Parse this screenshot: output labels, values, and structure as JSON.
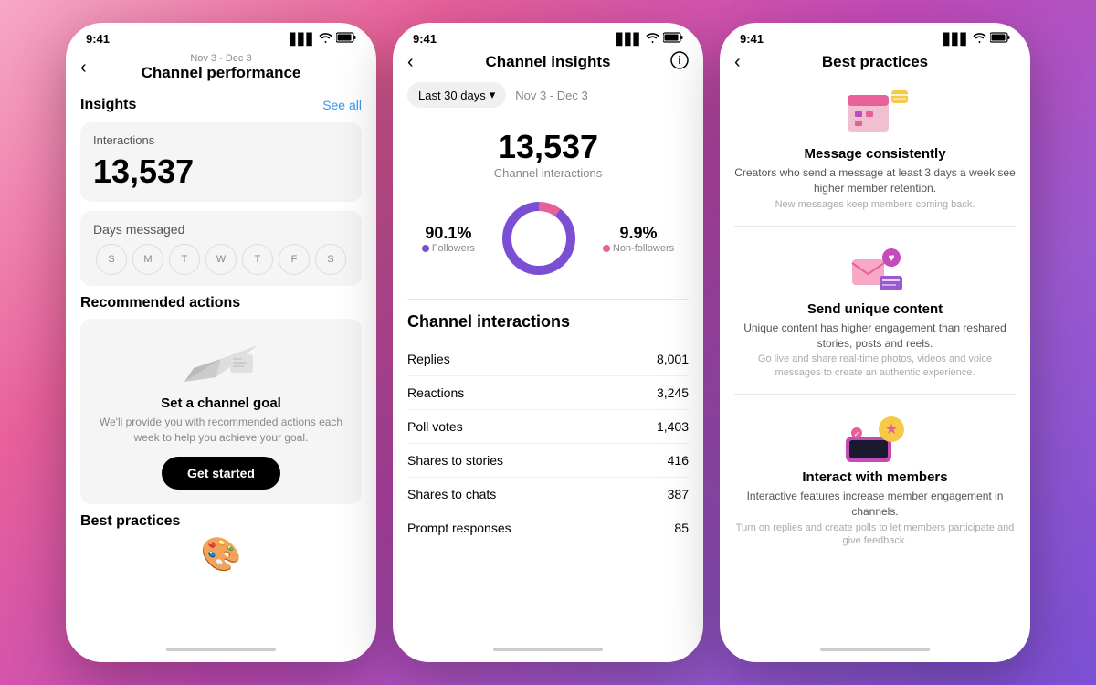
{
  "phone1": {
    "statusBar": {
      "time": "9:41",
      "signal": "▋▋▋",
      "wifi": "wifi",
      "battery": "🔋"
    },
    "nav": {
      "back": "‹",
      "dateRange": "Nov 3 - Dec 3",
      "title": "Channel performance"
    },
    "insights": {
      "sectionTitle": "Insights",
      "seeAll": "See all",
      "interactionsLabel": "Interactions",
      "interactionsValue": "13,537",
      "daysMessaged": "Days messaged",
      "days": [
        "S",
        "M",
        "T",
        "W",
        "T",
        "F",
        "S"
      ]
    },
    "recommended": {
      "title": "Recommended actions",
      "goalTitle": "Set a channel goal",
      "goalDesc": "We'll provide you with recommended actions each week to help you achieve your goal.",
      "buttonLabel": "Get started"
    },
    "bestPractices": {
      "title": "Best practices"
    }
  },
  "phone2": {
    "statusBar": {
      "time": "9:41"
    },
    "nav": {
      "back": "‹",
      "title": "Channel insights"
    },
    "dateFilter": {
      "label": "Last 30 days",
      "dateRange": "Nov 3 - Dec 3"
    },
    "hero": {
      "number": "13,537",
      "label": "Channel interactions"
    },
    "donut": {
      "followers": {
        "pct": "90.1%",
        "label": "Followers",
        "color": "#7b4fd4"
      },
      "nonFollowers": {
        "pct": "9.9%",
        "label": "Non-followers",
        "color": "#e8609a"
      }
    },
    "channelInteractions": {
      "title": "Channel interactions",
      "rows": [
        {
          "label": "Replies",
          "value": "8,001"
        },
        {
          "label": "Reactions",
          "value": "3,245"
        },
        {
          "label": "Poll votes",
          "value": "1,403"
        },
        {
          "label": "Shares to stories",
          "value": "416"
        },
        {
          "label": "Shares to chats",
          "value": "387"
        },
        {
          "label": "Prompt responses",
          "value": "85"
        }
      ]
    }
  },
  "phone3": {
    "statusBar": {
      "time": "9:41"
    },
    "nav": {
      "back": "‹",
      "title": "Best practices"
    },
    "items": [
      {
        "icon": "📅",
        "title": "Message consistently",
        "desc": "Creators who send a message at least 3 days a week see higher member retention.",
        "sub": "New messages keep members coming back."
      },
      {
        "icon": "💌",
        "title": "Send unique content",
        "desc": "Unique content has higher engagement than reshared stories, posts and reels.",
        "sub": "Go live and share real-time photos, videos and voice messages to create an authentic experience."
      },
      {
        "icon": "🎯",
        "title": "Interact with members",
        "desc": "Interactive features increase member engagement in channels.",
        "sub": "Turn on replies and create polls to let members participate and give feedback."
      }
    ]
  }
}
